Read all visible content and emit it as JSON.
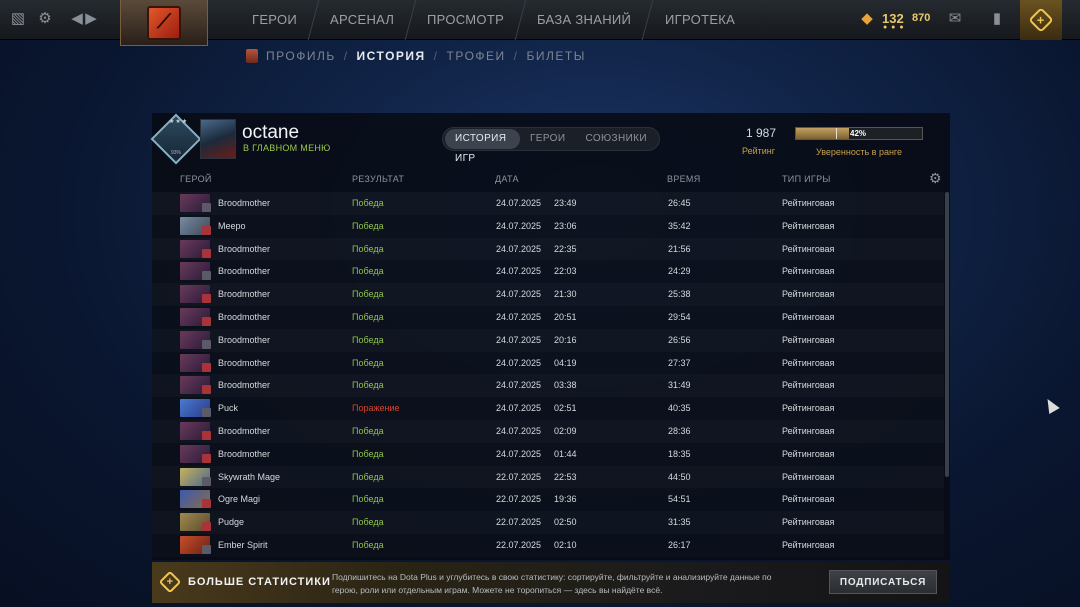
{
  "topbar": {
    "nav": [
      "ГЕРОИ",
      "АРСЕНАЛ",
      "ПРОСМОТР",
      "БАЗА ЗНАНИЙ",
      "ИГРОТЕКА"
    ],
    "shards": "132",
    "coins": "870",
    "shard_sub": "● ● ●"
  },
  "subnav": {
    "items": [
      "ПРОФИЛЬ",
      "ИСТОРИЯ",
      "ТРОФЕИ",
      "БИЛЕТЫ"
    ],
    "separator": "/"
  },
  "profile": {
    "name": "octane",
    "status": "В ГЛАВНОМ МЕНЮ",
    "rank_stars": "★★★",
    "rank_pct": "93%",
    "rating": "1 987",
    "rating_label": "Рейтинг",
    "confidence": "42%",
    "confidence_value": 0.42,
    "confidence_label": "Уверенность в ранге"
  },
  "tabs": [
    "ИСТОРИЯ ИГР",
    "ГЕРОИ",
    "СОЮЗНИКИ"
  ],
  "columns": {
    "hero": "ГЕРОЙ",
    "result": "РЕЗУЛЬТАТ",
    "date": "ДАТА",
    "time": "ВРЕМЯ",
    "type": "ТИП ИГРЫ"
  },
  "matches": [
    {
      "hero": "Broodmother",
      "result": "Победа",
      "win": true,
      "date": "24.07.2025",
      "clock": "23:49",
      "duration": "26:45",
      "type": "Рейтинговая"
    },
    {
      "hero": "Meepo",
      "result": "Победа",
      "win": true,
      "date": "24.07.2025",
      "clock": "23:06",
      "duration": "35:42",
      "type": "Рейтинговая"
    },
    {
      "hero": "Broodmother",
      "result": "Победа",
      "win": true,
      "date": "24.07.2025",
      "clock": "22:35",
      "duration": "21:56",
      "type": "Рейтинговая"
    },
    {
      "hero": "Broodmother",
      "result": "Победа",
      "win": true,
      "date": "24.07.2025",
      "clock": "22:03",
      "duration": "24:29",
      "type": "Рейтинговая"
    },
    {
      "hero": "Broodmother",
      "result": "Победа",
      "win": true,
      "date": "24.07.2025",
      "clock": "21:30",
      "duration": "25:38",
      "type": "Рейтинговая"
    },
    {
      "hero": "Broodmother",
      "result": "Победа",
      "win": true,
      "date": "24.07.2025",
      "clock": "20:51",
      "duration": "29:54",
      "type": "Рейтинговая"
    },
    {
      "hero": "Broodmother",
      "result": "Победа",
      "win": true,
      "date": "24.07.2025",
      "clock": "20:16",
      "duration": "26:56",
      "type": "Рейтинговая"
    },
    {
      "hero": "Broodmother",
      "result": "Победа",
      "win": true,
      "date": "24.07.2025",
      "clock": "04:19",
      "duration": "27:37",
      "type": "Рейтинговая"
    },
    {
      "hero": "Broodmother",
      "result": "Победа",
      "win": true,
      "date": "24.07.2025",
      "clock": "03:38",
      "duration": "31:49",
      "type": "Рейтинговая"
    },
    {
      "hero": "Puck",
      "result": "Поражение",
      "win": false,
      "date": "24.07.2025",
      "clock": "02:51",
      "duration": "40:35",
      "type": "Рейтинговая"
    },
    {
      "hero": "Broodmother",
      "result": "Победа",
      "win": true,
      "date": "24.07.2025",
      "clock": "02:09",
      "duration": "28:36",
      "type": "Рейтинговая"
    },
    {
      "hero": "Broodmother",
      "result": "Победа",
      "win": true,
      "date": "24.07.2025",
      "clock": "01:44",
      "duration": "18:35",
      "type": "Рейтинговая"
    },
    {
      "hero": "Skywrath Mage",
      "result": "Победа",
      "win": true,
      "date": "22.07.2025",
      "clock": "22:53",
      "duration": "44:50",
      "type": "Рейтинговая"
    },
    {
      "hero": "Ogre Magi",
      "result": "Победа",
      "win": true,
      "date": "22.07.2025",
      "clock": "19:36",
      "duration": "54:51",
      "type": "Рейтинговая"
    },
    {
      "hero": "Pudge",
      "result": "Победа",
      "win": true,
      "date": "22.07.2025",
      "clock": "02:50",
      "duration": "31:35",
      "type": "Рейтинговая"
    },
    {
      "hero": "Ember Spirit",
      "result": "Победа",
      "win": true,
      "date": "22.07.2025",
      "clock": "02:10",
      "duration": "26:17",
      "type": "Рейтинговая"
    }
  ],
  "banner": {
    "title": "БОЛЬШЕ СТАТИСТИКИ",
    "description": "Подпишитесь на Dota Plus и углубитесь в свою статистику: сортируйте, фильтруйте и анализируйте данные по герою, роли или отдельным играм. Можете не торопиться — здесь вы найдёте всё.",
    "button": "ПОДПИСАТЬСЯ"
  },
  "colors": {
    "win": "#8ec34a",
    "loss": "#d8432e",
    "gold": "#e8c96a"
  }
}
